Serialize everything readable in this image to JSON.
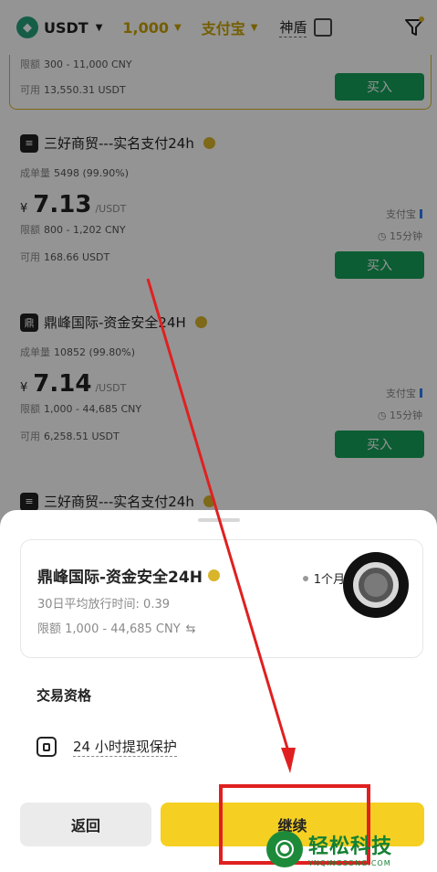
{
  "topbar": {
    "coin": "USDT",
    "amount": "1,000",
    "payment": "支付宝",
    "shield": "神盾"
  },
  "offers": [
    {
      "limit_label": "限额",
      "limit": "300 - 11,000 CNY",
      "avail_label": "可用",
      "avail": "13,550.31 USDT",
      "buy": "买入"
    },
    {
      "name": "三好商贸---实名支付24h",
      "vol_label": "成单量",
      "vol": "5498 (99.90%)",
      "cur": "¥",
      "price": "7.13",
      "unit": "/USDT",
      "limit_label": "限额",
      "limit": "800 - 1,202 CNY",
      "avail_label": "可用",
      "avail": "168.66 USDT",
      "pay": "支付宝",
      "time": "15分钟",
      "buy": "买入"
    },
    {
      "name": "鼎峰国际-资金安全24H",
      "vol_label": "成单量",
      "vol": "10852 (99.80%)",
      "cur": "¥",
      "price": "7.14",
      "unit": "/USDT",
      "limit_label": "限额",
      "limit": "1,000 - 44,685 CNY",
      "avail_label": "可用",
      "avail": "6,258.51 USDT",
      "pay": "支付宝",
      "time": "15分钟",
      "buy": "买入"
    },
    {
      "name": "三好商贸---实名支付24h"
    }
  ],
  "sheet": {
    "merchant_name": "鼎峰国际-资金安全24H",
    "online": "1个月前",
    "avg_release": "30日平均放行时间: 0.39",
    "limit": "限额 1,000 - 44,685 CNY",
    "qual_title": "交易资格",
    "qual_item": "24 小时提现保护",
    "back": "返回",
    "continue": "继续"
  },
  "watermark": {
    "cn": "轻松科技",
    "en": "YNQINGSONG.COM"
  },
  "colors": {
    "accent_yellow": "#f5d022",
    "buy_green": "#16a05a",
    "highlight_red": "#e02020"
  }
}
